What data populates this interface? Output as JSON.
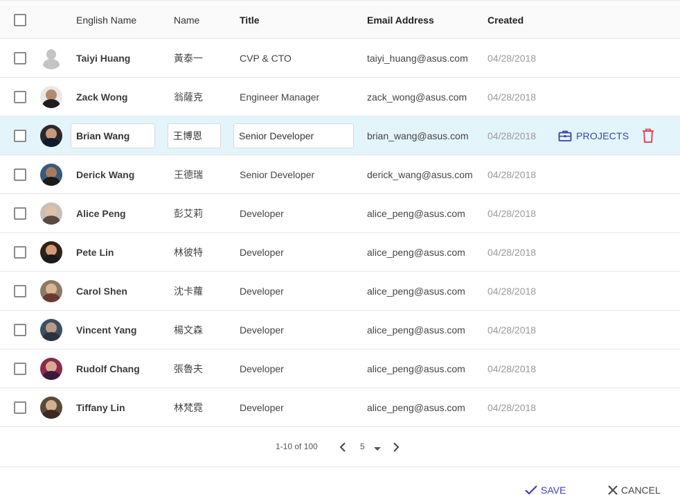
{
  "header": {
    "english_name": "English Name",
    "name": "Name",
    "title": "Title",
    "email": "Email Address",
    "created": "Created"
  },
  "rows": [
    {
      "english_name": "Taiyi Huang",
      "name": "黃泰一",
      "title": "CVP & CTO",
      "email": "taiyi_huang@asus.com",
      "created": "04/28/2018",
      "avatar": "default-avatar"
    },
    {
      "english_name": "Zack Wong",
      "name": "翁薩克",
      "title": "Engineer Manager",
      "email": "zack_wong@asus.com",
      "created": "04/28/2018",
      "avatar": "photo"
    },
    {
      "english_name": "Brian Wang",
      "name": "王博恩",
      "title": "Senior Developer",
      "email": "brian_wang@asus.com",
      "created": "04/28/2018",
      "avatar": "photo"
    },
    {
      "english_name": "Derick Wang",
      "name": "王德瑞",
      "title": "Senior Developer",
      "email": "derick_wang@asus.com",
      "created": "04/28/2018",
      "avatar": "photo"
    },
    {
      "english_name": "Alice Peng",
      "name": "彭艾莉",
      "title": "Developer",
      "email": "alice_peng@asus.com",
      "created": "04/28/2018",
      "avatar": "photo"
    },
    {
      "english_name": "Pete Lin",
      "name": "林彼特",
      "title": "Developer",
      "email": "alice_peng@asus.com",
      "created": "04/28/2018",
      "avatar": "photo"
    },
    {
      "english_name": "Carol Shen",
      "name": "沈卡蘿",
      "title": "Developer",
      "email": "alice_peng@asus.com",
      "created": "04/28/2018",
      "avatar": "photo"
    },
    {
      "english_name": "Vincent Yang",
      "name": "楊文森",
      "title": "Developer",
      "email": "alice_peng@asus.com",
      "created": "04/28/2018",
      "avatar": "photo"
    },
    {
      "english_name": "Rudolf Chang",
      "name": "張魯夫",
      "title": "Developer",
      "email": "alice_peng@asus.com",
      "created": "04/28/2018",
      "avatar": "photo"
    },
    {
      "english_name": "Tiffany Lin",
      "name": "林梵霓",
      "title": "Developer",
      "email": "alice_peng@asus.com",
      "created": "04/28/2018",
      "avatar": "photo"
    }
  ],
  "editing_row": {
    "index": 2,
    "projects_label": "PROJECTS"
  },
  "pagination": {
    "range": "1-10 of 100",
    "page_size": "5"
  },
  "footer": {
    "save_label": "SAVE",
    "cancel_label": "CANCEL"
  },
  "colors": {
    "accent": "#3a3fae",
    "selected_row": "#e3f4fb",
    "delete": "#e0475a"
  },
  "icons": [
    "briefcase-icon",
    "trash-icon",
    "chevron-left-icon",
    "chevron-right-icon",
    "caret-down-icon",
    "check-icon",
    "close-icon"
  ]
}
